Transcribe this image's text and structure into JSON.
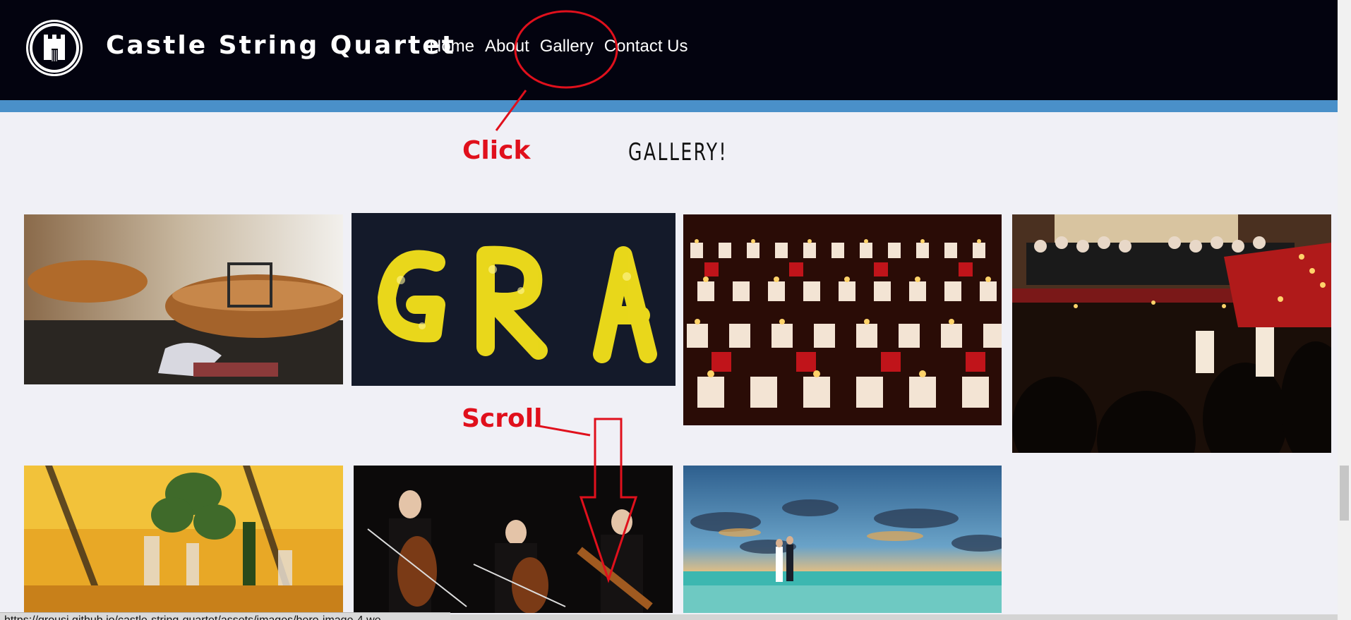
{
  "site": {
    "title": "Castle String Quartet",
    "logo_icon": "castle-violin-icon"
  },
  "nav": {
    "items": [
      "Home",
      "About",
      "Gallery",
      "Contact Us"
    ]
  },
  "main": {
    "heading": "GALLERY!"
  },
  "gallery": {
    "images": [
      "violin-on-table-photo",
      "gra-candle-letters-photo",
      "red-white-candles-photo",
      "choir-concert-photo",
      "wedding-table-decor-photo",
      "cellists-performing-photo",
      "beach-wedding-couple-photo"
    ]
  },
  "annotations": {
    "click_label": "Click",
    "scroll_label": "Scroll",
    "color": "#e0101c"
  },
  "status_bar": {
    "url": "https://grousi.github.io/castle-string-quartet/assets/images/hero-image-4.we..."
  },
  "colors": {
    "header_bg": "#03030f",
    "accent_strip": "#4a90c9",
    "page_bg": "#f0f0f6"
  }
}
